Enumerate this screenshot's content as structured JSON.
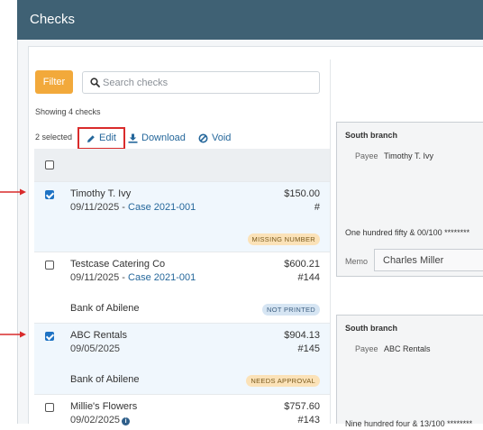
{
  "header": {
    "title": "Checks"
  },
  "toolbar": {
    "filter_label": "Filter",
    "search_placeholder": "Search checks"
  },
  "list_info": {
    "showing": "Showing 4 checks",
    "selected": "2 selected"
  },
  "actions": {
    "edit": "Edit",
    "download": "Download",
    "void": "Void"
  },
  "checks": [
    {
      "payee": "Timothy T. Ivy",
      "date": "09/11/2025",
      "separator": " - ",
      "case": "Case 2021-001",
      "amount": "$150.00",
      "number": "#",
      "bank": "",
      "status": "MISSING NUMBER",
      "selected": true
    },
    {
      "payee": "Testcase Catering Co",
      "date": "09/11/2025",
      "separator": " - ",
      "case": "Case 2021-001",
      "amount": "$600.21",
      "number": "#144",
      "bank": "Bank of Abilene",
      "status": "NOT PRINTED",
      "selected": false
    },
    {
      "payee": "ABC Rentals",
      "date": "09/05/2025",
      "case": "",
      "amount": "$904.13",
      "number": "#145",
      "bank": "Bank of Abilene",
      "status": "NEEDS APPROVAL",
      "selected": true
    },
    {
      "payee": "Millie's Flowers",
      "date": "09/02/2025",
      "case": "",
      "amount": "$757.60",
      "number": "#143",
      "bank": "",
      "status": "",
      "selected": false
    }
  ],
  "previews": [
    {
      "branch": "South branch",
      "payee_label": "Payee",
      "payee": "Timothy T. Ivy",
      "amount_words": "One hundred fifty & 00/100 ********",
      "memo_label": "Memo",
      "memo": "Charles Miller"
    },
    {
      "branch": "South branch",
      "payee_label": "Payee",
      "payee": "ABC Rentals",
      "amount_words": "Nine hundred four & 13/100 ********",
      "memo_label": "",
      "memo": ""
    }
  ],
  "colors": {
    "header": "#3f6174",
    "filter": "#f2a93b",
    "link": "#25679b",
    "checkbox": "#1f73c4",
    "annotation": "#d92b2b"
  }
}
